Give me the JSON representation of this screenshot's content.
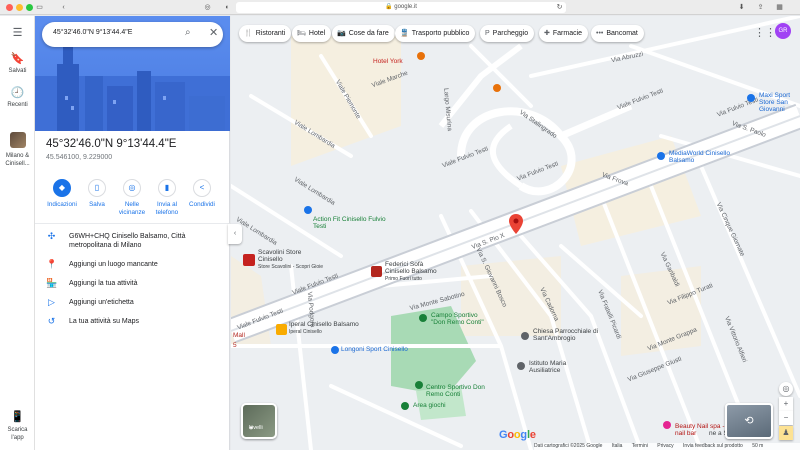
{
  "browser": {
    "url": "google.it"
  },
  "rail": {
    "saved": "Salvati",
    "recent": "Recenti",
    "recent_place": "Milano & Cinisell...",
    "download_app": "Scarica l'app"
  },
  "search": {
    "query": "45°32'46.0\"N 9°13'44.4\"E"
  },
  "place": {
    "title": "45°32'46.0\"N 9°13'44.4\"E",
    "decimal": "45.546100, 9.229000"
  },
  "actions": [
    {
      "label": "Indicazioni",
      "icon": "directions-icon"
    },
    {
      "label": "Salva",
      "icon": "bookmark-icon"
    },
    {
      "label": "Nelle vicinanze",
      "icon": "nearby-icon"
    },
    {
      "label": "Invia al telefono",
      "icon": "phone-icon"
    },
    {
      "label": "Condividi",
      "icon": "share-icon"
    }
  ],
  "details": [
    {
      "text": "G6WH+CHQ Cinisello Balsamo, Città metropolitana di Milano",
      "icon": "plus-code-icon"
    },
    {
      "text": "Aggiungi un luogo mancante",
      "icon": "add-place-icon"
    },
    {
      "text": "Aggiungi la tua attività",
      "icon": "business-icon"
    },
    {
      "text": "Aggiungi un'etichetta",
      "icon": "label-icon"
    },
    {
      "text": "La tua attività su Maps",
      "icon": "history-icon"
    }
  ],
  "chips": [
    "Ristoranti",
    "Hotel",
    "Cose da fare",
    "Trasporto pubblico",
    "Parcheggio",
    "Farmacie",
    "Bancomat"
  ],
  "avatar": "GR",
  "map_labels": {
    "fulvio_1": "Viale Fulvio Testi",
    "fulvio_2": "Viale Fulvio Testi",
    "fulvio_3": "Viale Fulvio Testi",
    "fulvio_4": "Via Fulvio Testi",
    "fulvio_5": "Via Fulvio Testi",
    "fulvio_6": "Viale Fulvio Testi",
    "lombardia_1": "Viale Lombardia",
    "lombardia_2": "Viale Lombardia",
    "lombardia_3": "Viale Lombardia",
    "marche": "Viale Marche",
    "abruzzi": "Via Abruzzi",
    "piemonte": "Viale Piemonte",
    "stalingrado": "Via Stalingrado",
    "san_paolo": "Via S. Paolo",
    "pio_x": "Via S. Pio X",
    "bosco": "Via S. Giovanni Bosco",
    "monte_sabotino": "Via Monte Sabotino",
    "podgora": "Via Podgora",
    "frova": "Via Frova",
    "cadorna": "Via Cadorna",
    "fratelli_picardi": "Via Fratelli Picardi",
    "monte_grappa": "Via Monte Grappa",
    "garibaldi": "Via Garibaldi",
    "vittorio_alfieri": "Via Vittorio Alfieri",
    "giuseppe_giusti": "Via Giuseppe Giusti",
    "cinque": "Via Cinque Giornate",
    "lago_misurina": "Largo Misurina",
    "turati": "Via Filippo Turati"
  },
  "pois": {
    "hotel_york": "Hotel York",
    "maxi_sport": "Maxi Sport Store San Giovanni",
    "mediaworld": "MediaWorld Cinisello Balsamo",
    "action_fit": "Action Fit Cinisello Fulvio Testi",
    "scavolini": "Scavolini Store Cinisello",
    "scavolini_sub": "Store Scavolini - Scopri Gioie",
    "federici": "Federici Sofà Cinisello Balsamo",
    "federici_sub": "Primo Fuori tutto",
    "iperal": "Iperal Cinisello Balsamo",
    "iperal_sub": "Iperal Cinisello",
    "longoni": "Longoni Sport Cinisello",
    "campo": "Campo Sportivo \"Don Remo Conti\"",
    "centro": "Centro Sportivo Don Remo Conti",
    "chiesa": "Chiesa Parrocchiale di Sant'Ambrogio",
    "auxiliatrice": "Istituto Maria Ausiliatrice",
    "area_giochi": "Area giochi",
    "beauty": "Beauty Nail spa - nail bar",
    "sesto": "ne a Sesto Sa",
    "mall": "Mall",
    "lato": "5"
  },
  "controls": {
    "layers": "Livelli",
    "zoom_in": "+",
    "zoom_out": "−"
  },
  "google": [
    "G",
    "o",
    "o",
    "g",
    "l",
    "e"
  ],
  "footer": {
    "data": "Dati cartografici ©2025 Google",
    "country": "Italia",
    "terms": "Termini",
    "privacy": "Privacy",
    "feedback": "Invia feedback sul prodotto",
    "scale": "50 m"
  },
  "colors": {
    "accent": "#1a73e8",
    "pin": "#ea4335",
    "park": "#a8dab5",
    "highway": "#ffffff"
  }
}
